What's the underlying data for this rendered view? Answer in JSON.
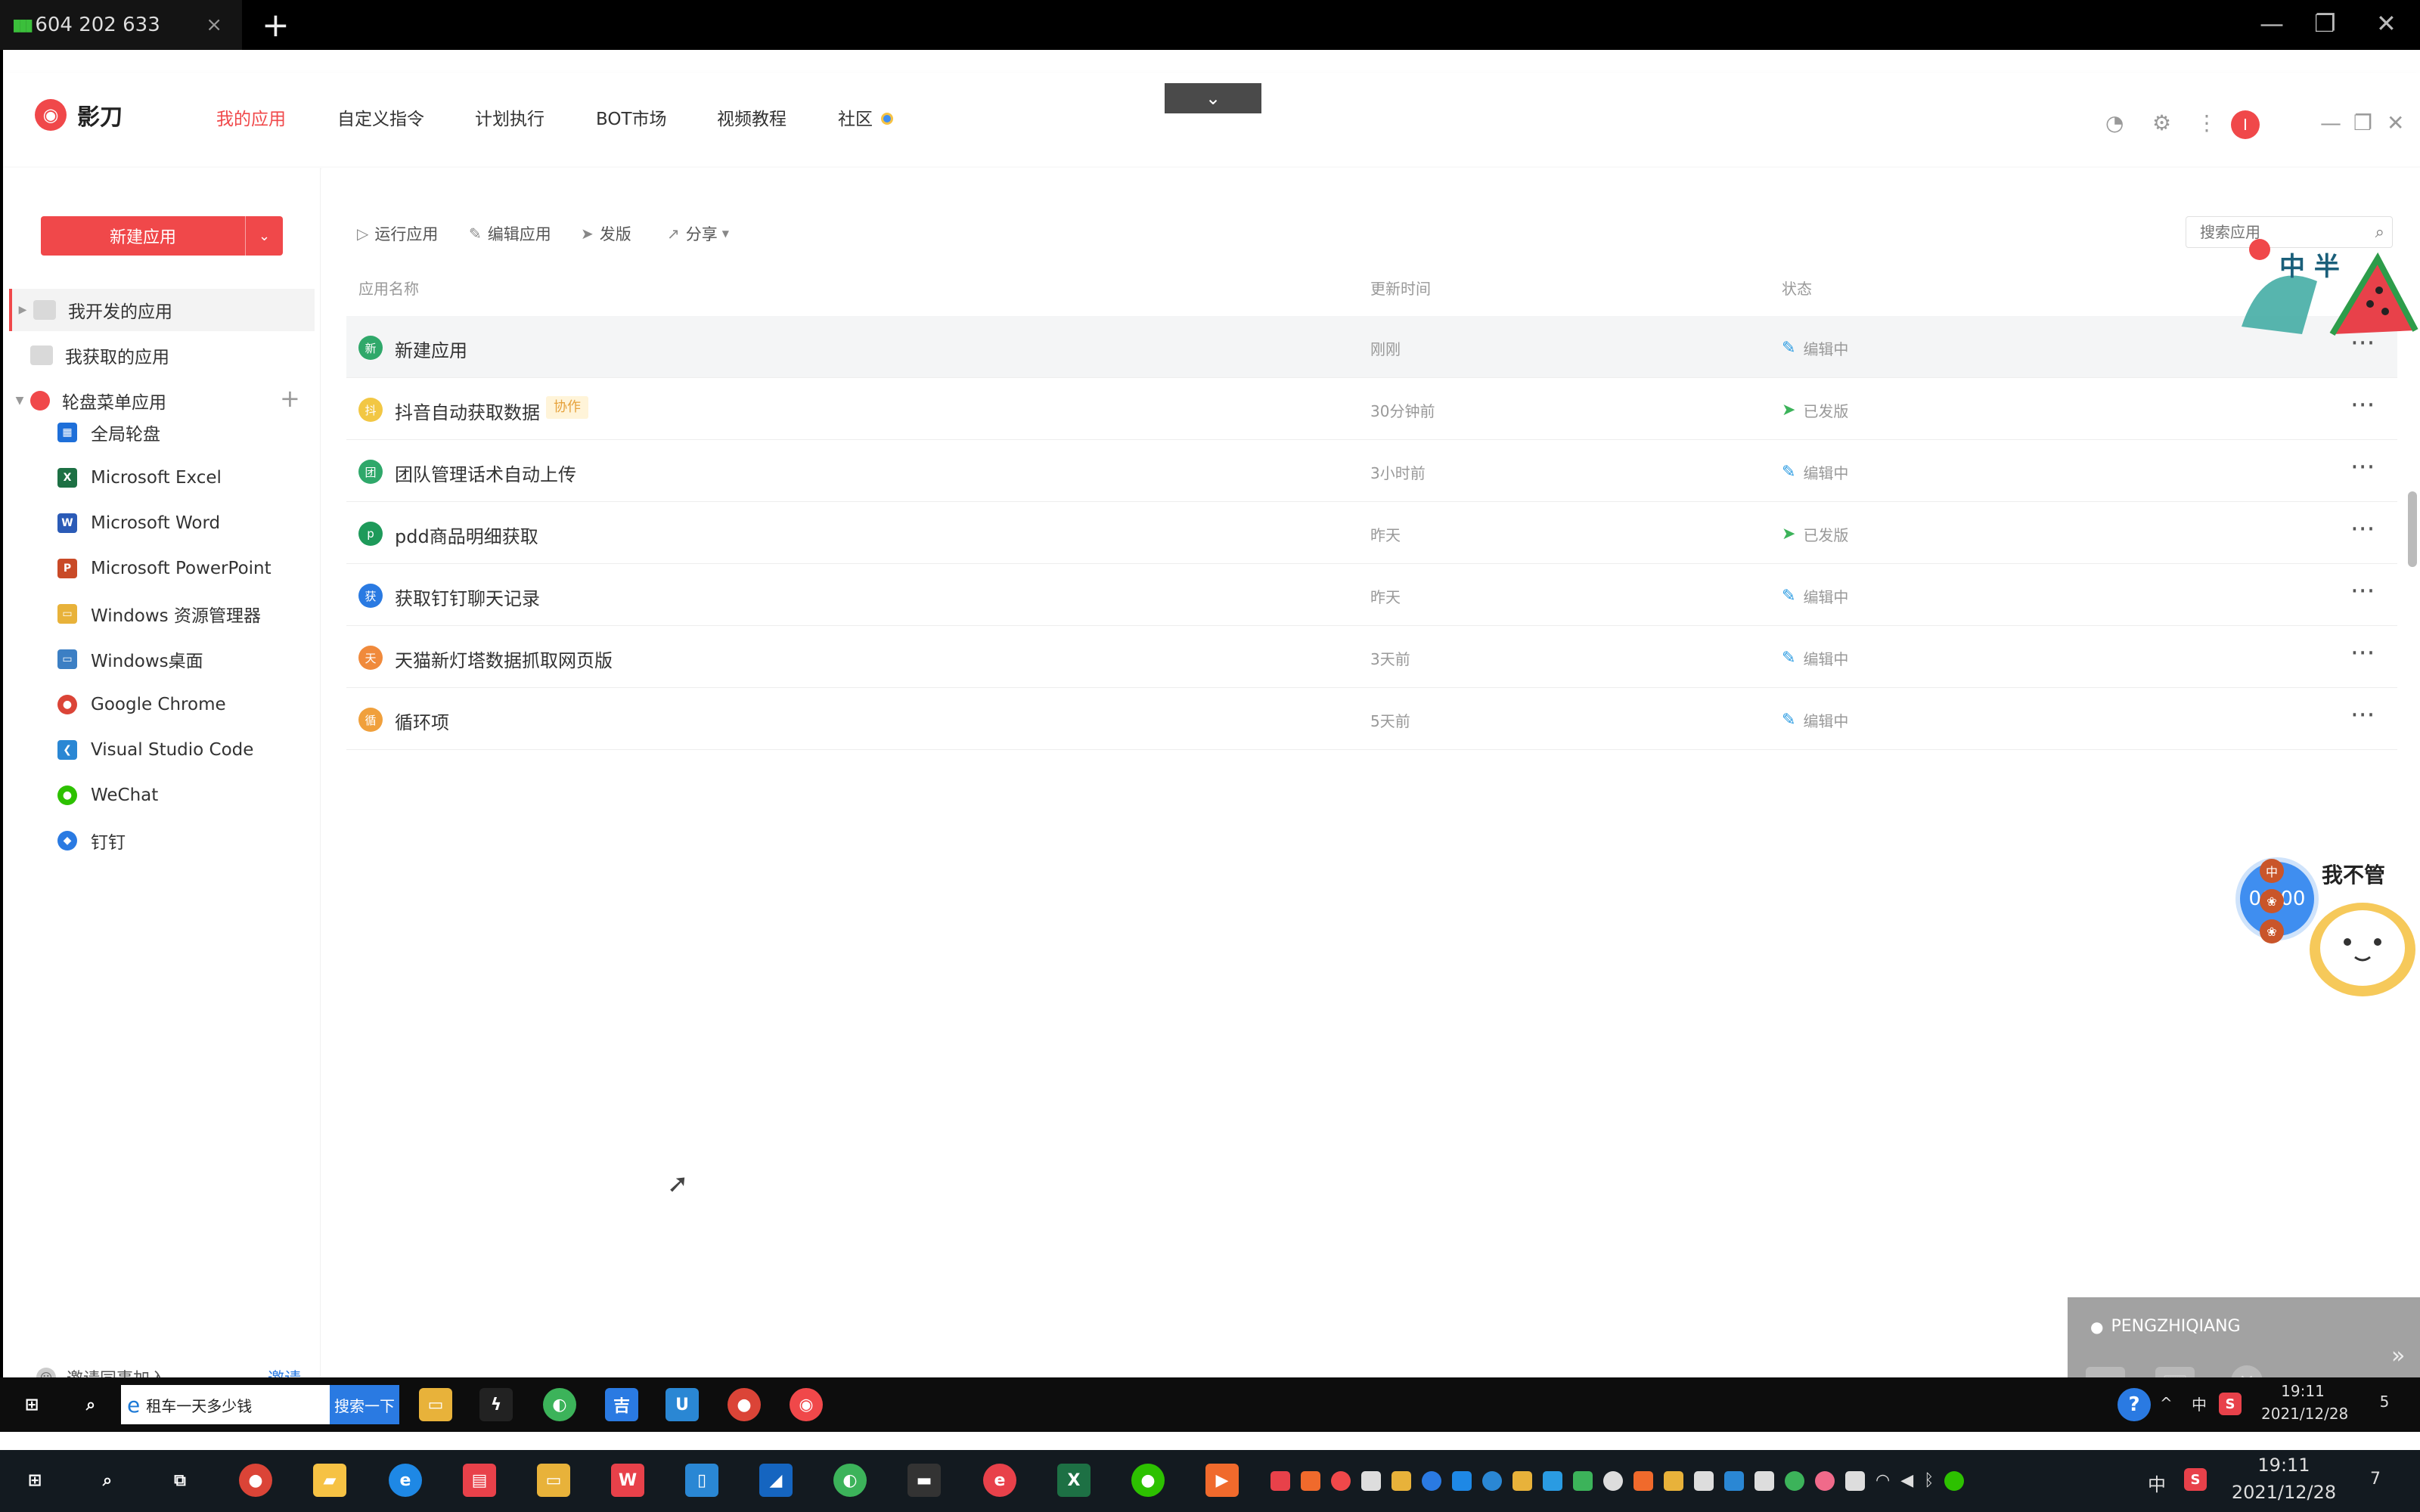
{
  "remote": {
    "tab_title": "604 202 633",
    "close": "×",
    "add": "+"
  },
  "app": {
    "logo_text": "影刀",
    "nav": [
      "我的应用",
      "自定义指令",
      "计划执行",
      "BOT市场",
      "视频教程",
      "社区"
    ],
    "active_nav": "我的应用",
    "collapse_icon": "chevron-down-icon"
  },
  "sidebar": {
    "new_app_label": "新建应用",
    "groups": [
      {
        "label": "我开发的应用",
        "active": true
      },
      {
        "label": "我获取的应用",
        "active": false
      },
      {
        "label": "轮盘菜单应用",
        "active": false
      }
    ],
    "carousel_items": [
      {
        "label": "全局轮盘",
        "color": "#1e6fd9",
        "glyph": "▦"
      },
      {
        "label": "Microsoft Excel",
        "color": "#1d7044",
        "glyph": "X"
      },
      {
        "label": "Microsoft Word",
        "color": "#2b5bb7",
        "glyph": "W"
      },
      {
        "label": "Microsoft PowerPoint",
        "color": "#c94a27",
        "glyph": "P"
      },
      {
        "label": "Windows 资源管理器",
        "color": "#e8b23a",
        "glyph": "▭"
      },
      {
        "label": "Windows桌面",
        "color": "#3c7fc4",
        "glyph": "▭"
      },
      {
        "label": "Google Chrome",
        "color": "#db4437",
        "glyph": "●"
      },
      {
        "label": "Visual Studio Code",
        "color": "#2a87d4",
        "glyph": "❮"
      },
      {
        "label": "WeChat",
        "color": "#2dc100",
        "glyph": "●"
      },
      {
        "label": "钉钉",
        "color": "#2a7ae2",
        "glyph": "◆"
      }
    ],
    "invite_text": "邀请同事加入",
    "invite_link": "邀请"
  },
  "toolbar": {
    "run": "运行应用",
    "edit": "编辑应用",
    "publish": "发版",
    "share": "分享",
    "search_placeholder": "搜索应用"
  },
  "table": {
    "headers": [
      "应用名称",
      "更新时间",
      "状态"
    ],
    "rows": [
      {
        "badge": "新",
        "badge_color": "#2fa86a",
        "name": "新建应用",
        "tag": "",
        "time": "刚刚",
        "status": "编辑中",
        "status_kind": "editing"
      },
      {
        "badge": "抖",
        "badge_color": "#f2c744",
        "name": "抖音自动获取数据",
        "tag": "协作",
        "time": "30分钟前",
        "status": "已发版",
        "status_kind": "published"
      },
      {
        "badge": "团",
        "badge_color": "#2fa86a",
        "name": "团队管理话术自动上传",
        "tag": "",
        "time": "3小时前",
        "status": "编辑中",
        "status_kind": "editing"
      },
      {
        "badge": "p",
        "badge_color": "#1e9a5a",
        "name": "pdd商品明细获取",
        "tag": "",
        "time": "昨天",
        "status": "已发版",
        "status_kind": "published"
      },
      {
        "badge": "获",
        "badge_color": "#2a7ae2",
        "name": "获取钉钉聊天记录",
        "tag": "",
        "time": "昨天",
        "status": "编辑中",
        "status_kind": "editing"
      },
      {
        "badge": "天",
        "badge_color": "#f08a3c",
        "name": "天猫新灯塔数据抓取网页版",
        "tag": "",
        "time": "3天前",
        "status": "编辑中",
        "status_kind": "editing"
      },
      {
        "badge": "循",
        "badge_color": "#f0a03c",
        "name": "循环项",
        "tag": "",
        "time": "5天前",
        "status": "编辑中",
        "status_kind": "editing"
      }
    ],
    "more": "···"
  },
  "overlays": {
    "sticker_text": "中 半",
    "timer": "00:00",
    "timer_marks": [
      "中",
      "❀",
      "❀"
    ],
    "cat_caption": "我不管",
    "meeting_user": "PENGZHIQIANG"
  },
  "remote_taskbar": {
    "search_value": "租车一天多少钱",
    "search_button": "搜索一下",
    "ime": "中",
    "time": "19:11",
    "date": "2021/12/28",
    "notifications": "5"
  },
  "local_taskbar": {
    "ime": "中",
    "time": "19:11",
    "date": "2021/12/28",
    "notifications": "7"
  },
  "colors": {
    "accent": "#f0484a",
    "published": "#3cb35a",
    "editing": "#2a9be2"
  }
}
